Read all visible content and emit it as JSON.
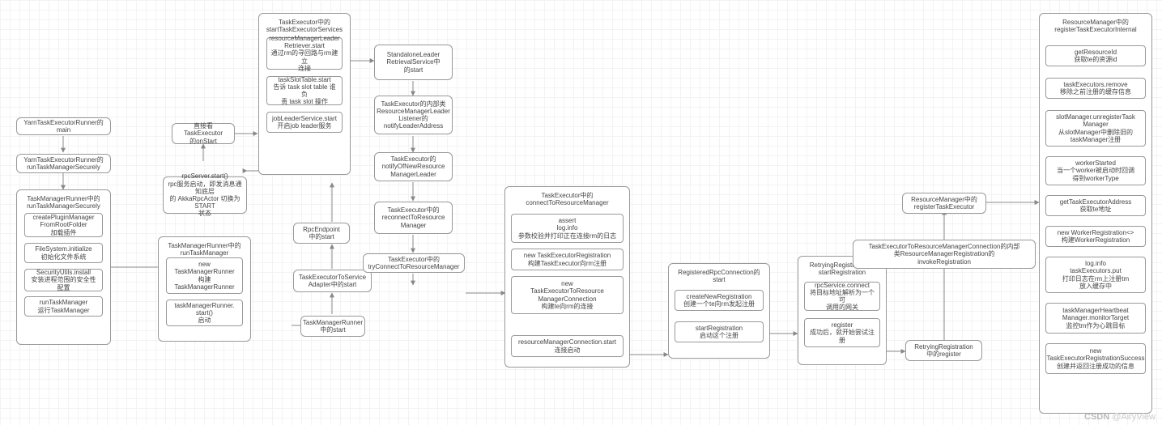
{
  "watermark": {
    "left": "CSDN",
    "right": "@AiryView"
  },
  "n1": "YarnTaskExecutorRunner的main",
  "n2": "YarnTaskExecutorRunner的\nrunTaskManagerSecurely",
  "n3": {
    "title": "TaskManagerRunner中的\nrunTaskManagerSecurely",
    "c1": "createPluginManager\nFromRootFolder\n加载插件",
    "c2": "FileSystem.initialize\n初始化文件系统",
    "c3": "SecurityUtils.install\n安装进程范围的安全性配置",
    "c4": "runTaskManager\n运行TaskManager"
  },
  "n4": {
    "title": "TaskManagerRunner中的\nrunTaskManager",
    "c1": "new\nTaskManagerRunner\n构建\nTaskManagerRunner",
    "c2": "taskManagerRunner.\nstart()\n启动"
  },
  "n5": "rpcServer.start()\nrpc服务启动，即发消息通知底层\n的 AkkaRpcActor 切换为 START\n状态",
  "n6": "直接看TaskExecutor\n的onStart",
  "n7": "RpcEndpoint\n中的start",
  "n8": "TaskExecutorToService\nAdapter中的start",
  "n9": "TaskManagerRunner\n中的start",
  "n10": {
    "title": "TaskExecutor中的\nstartTaskExecutorServices",
    "c1": "resourceManagerLeader\nRetriever.start\n通过rm的寻回路与rm建立\n连接",
    "c2": "taskSlotTable.start\n告诉 task slot table 谁负\n责 task slot 操作",
    "c3": "jobLeaderService.start\n开启job leader服务"
  },
  "n11": "StandaloneLeader\nRetrievalService中\n的start",
  "n12": "TaskExecutor的内部类\nResourceManagerLeader\nListener的\nnotifyLeaderAddress",
  "n13": "TaskExecutor的\nnotifyOfNewResource\nManagerLeader",
  "n14": "TaskExecutor中的\nreconnectToResource\nManager",
  "n15": "TaskExecutor中的\ntryConnectToResourceManager",
  "n16": {
    "title": "TaskExecutor中的\nconnectToResourceManager",
    "c1": "assert\nlog.info\n参数校验并打印正在连接rm的日志",
    "c2": "new TaskExecutorRegistration\n构建TaskExecutor向rm注册",
    "c3": "new\nTaskExecutorToResource\nManagerConnection\n构建te向rm的连接",
    "c4": "resourceManagerConnection.start\n连接启动"
  },
  "n17": {
    "title": "RegisteredRpcConnection的\nstart",
    "c1": "createNewRegistration\n创建一个te向rm发起注册",
    "c2": "startRegistration\n启动这个注册"
  },
  "n18": {
    "title": "RetryingRegistration的\nstartRegistration",
    "c1": "rpcService.connect\n将目标地址解析为一个可\n调用的网关",
    "c2": "register\n成功后，就开始尝试注\n册"
  },
  "n19": "RetryingRegistration\n中的register",
  "n20": "TaskExecutorToResourceManagerConnection的内部\n类ResourceManagerRegistration的\ninvokeRegistration",
  "n21": "ResourceManager中的\nregisterTaskExecutor",
  "n22": {
    "title": "ResourceManager中的\nregisterTaskExecutorInternal",
    "c1": "getResourceId\n获取te的资源id",
    "c2": "taskExecutors.remove\n移除之前注册的缓存信息",
    "c3": "slotManager.unregisterTask\nManager\n从slotManager中删除旧的\ntaskManager注册",
    "c4": "workerStarted\n当一个worker被启动时回调\n得到workerType",
    "c5": "getTaskExecutorAddress\n获取te地址",
    "c6": "new WorkerRegistration<>\n构建WorkerRegistration",
    "c7": "log.info\ntaskExecutors.put\n打印日志在rm上注册tm\n放入缓存中",
    "c8": "taskManagerHeartbeat\nManager.monitorTarget\n监控tm作为心跳目标",
    "c9": "new\nTaskExecutorRegistrationSuccess\n创建并返回注册成功的信息"
  }
}
